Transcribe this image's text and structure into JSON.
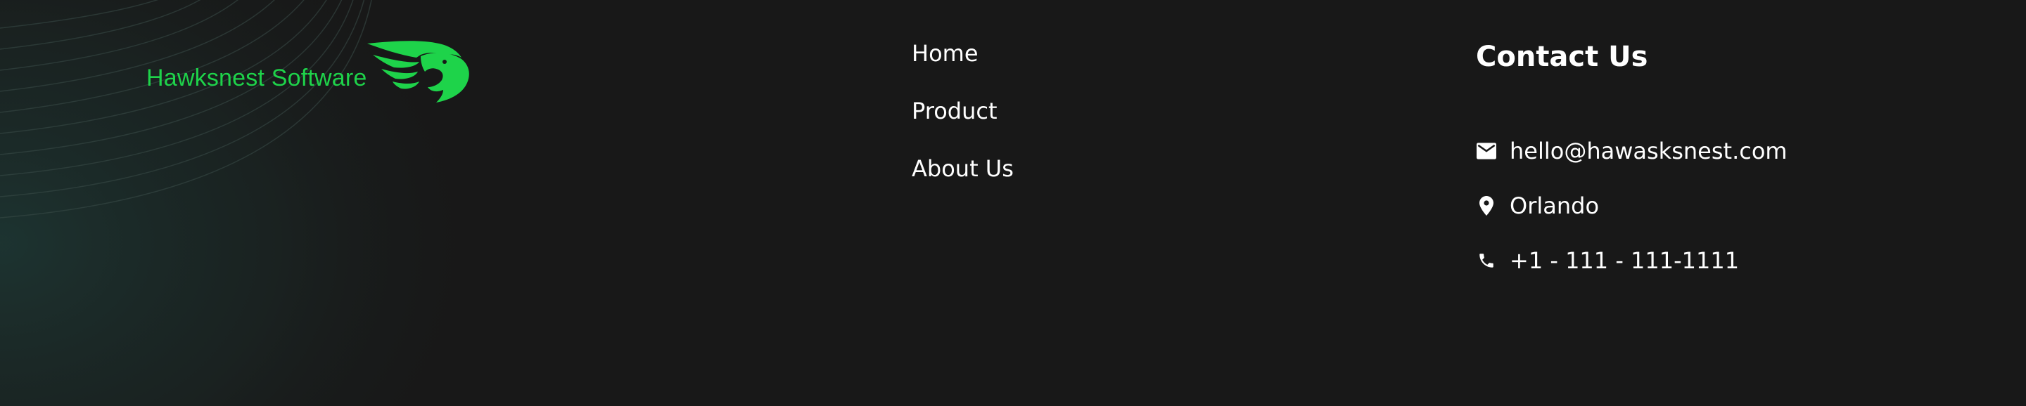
{
  "brand": {
    "name": "Hawksnest Software",
    "logo_icon": "hawk-logo-icon",
    "color": "#1ed34a"
  },
  "nav": {
    "items": [
      {
        "label": "Home"
      },
      {
        "label": "Product"
      },
      {
        "label": "About Us"
      }
    ]
  },
  "contact": {
    "title": "Contact Us",
    "items": [
      {
        "icon": "mail-icon",
        "text": "hello@hawasksnest.com"
      },
      {
        "icon": "location-pin-icon",
        "text": "Orlando"
      },
      {
        "icon": "phone-icon",
        "text": "+1 - 111 - 111-1111"
      }
    ]
  },
  "colors": {
    "background": "#181818",
    "text": "#ffffff",
    "accent": "#1ed34a",
    "glow": "#1c2e2b"
  }
}
